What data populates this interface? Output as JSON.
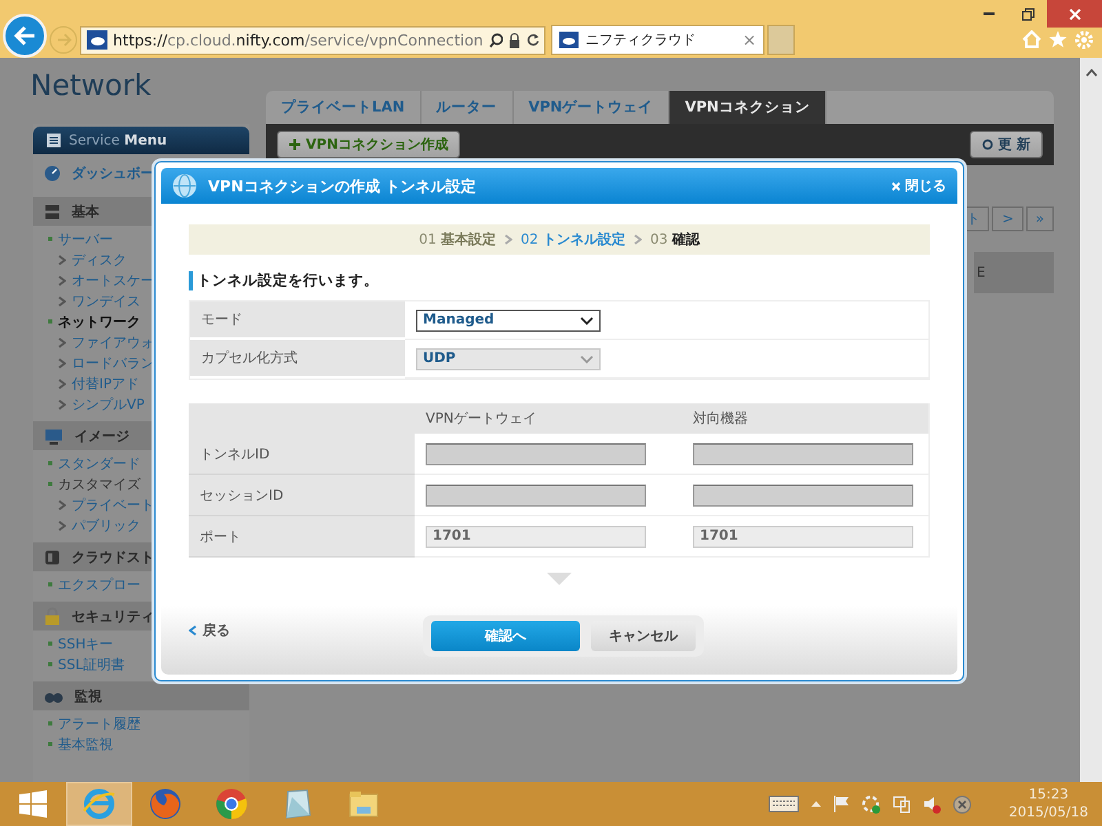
{
  "browser": {
    "url_parts": [
      {
        "text": "https://",
        "emphasis": true
      },
      {
        "text": "cp.cloud.",
        "emphasis": false
      },
      {
        "text": "nifty.com",
        "emphasis": true
      },
      {
        "text": "/service/vpnConnection",
        "emphasis": false
      }
    ],
    "tab_title": "ニフティクラウド",
    "tab_close": "×"
  },
  "page": {
    "header_title": "Network",
    "tabs": [
      {
        "label": "プライベートLAN",
        "selected": false
      },
      {
        "label": "ルーター",
        "selected": false
      },
      {
        "label": "VPNゲートウェイ",
        "selected": false
      },
      {
        "label": "VPNコネクション",
        "selected": true
      }
    ],
    "create_button": "VPNコネクション作成",
    "refresh_button": "更 新",
    "pager": [
      "ト",
      ">",
      "»"
    ],
    "list_fragment": "E"
  },
  "sidebar": {
    "header_light": "Service",
    "header_bold": "Menu",
    "sections": [
      {
        "title": "ダッシュボー",
        "kind": "link"
      },
      {
        "title": "基本",
        "kind": "group",
        "children": [
          {
            "label": "サーバー",
            "kind": "link",
            "children": [
              {
                "label": "ディスク"
              },
              {
                "label": "オートスケー"
              },
              {
                "label": "ワンデイス"
              }
            ]
          },
          {
            "label": "ネットワーク",
            "kind": "current",
            "children": [
              {
                "label": "ファイアウォ"
              },
              {
                "label": "ロードバラン"
              },
              {
                "label": "付替IPアド"
              },
              {
                "label": "シンプルVP"
              }
            ]
          }
        ]
      },
      {
        "title": "イメージ",
        "kind": "group",
        "children": [
          {
            "label": "スタンダード",
            "kind": "link"
          },
          {
            "label": "カスタマイズ",
            "kind": "label",
            "children": [
              {
                "label": "プライベート"
              },
              {
                "label": "パブリック"
              }
            ]
          }
        ]
      },
      {
        "title": "クラウドスト",
        "kind": "group",
        "children": [
          {
            "label": "エクスプロー",
            "kind": "link"
          }
        ]
      },
      {
        "title": "セキュリティ",
        "kind": "group",
        "children": [
          {
            "label": "SSHキー",
            "kind": "link"
          },
          {
            "label": "SSL証明書",
            "kind": "link"
          }
        ]
      },
      {
        "title": "監視",
        "kind": "group",
        "children": [
          {
            "label": "アラート履歴",
            "kind": "link"
          },
          {
            "label": "基本監視",
            "kind": "link"
          }
        ]
      }
    ]
  },
  "dialog": {
    "title": "VPNコネクションの作成 トンネル設定",
    "close": "閉じる",
    "steps": [
      {
        "number": "01",
        "label": "基本設定",
        "kind": "done"
      },
      {
        "number": "02",
        "label": "トンネル設定",
        "kind": "current"
      },
      {
        "number": "03",
        "label": "確認",
        "kind": "next"
      }
    ],
    "heading": "トンネル設定を行います。",
    "form": [
      {
        "label": "モード",
        "value": "Managed",
        "disabled": false
      },
      {
        "label": "カプセル化方式",
        "value": "UDP",
        "disabled": true
      }
    ],
    "columns": [
      "VPNゲートウェイ",
      "対向機器"
    ],
    "rows": [
      {
        "label": "トンネルID",
        "cells": [
          {
            "readonly": false
          },
          {
            "readonly": false
          }
        ]
      },
      {
        "label": "セッションID",
        "cells": [
          {
            "readonly": false
          },
          {
            "readonly": false
          }
        ]
      },
      {
        "label": "ポート",
        "cells": [
          {
            "value": "1701",
            "readonly": true
          },
          {
            "value": "1701",
            "readonly": true
          }
        ]
      }
    ],
    "back": "戻る",
    "primary_button": "確認へ",
    "cancel_button": "キャンセル"
  },
  "taskbar": {
    "apps": [
      {
        "selected": true
      },
      {
        "selected": false
      },
      {
        "selected": false
      },
      {
        "selected": false
      },
      {
        "selected": false
      }
    ],
    "time": "15:23",
    "date": "2015/05/18"
  }
}
